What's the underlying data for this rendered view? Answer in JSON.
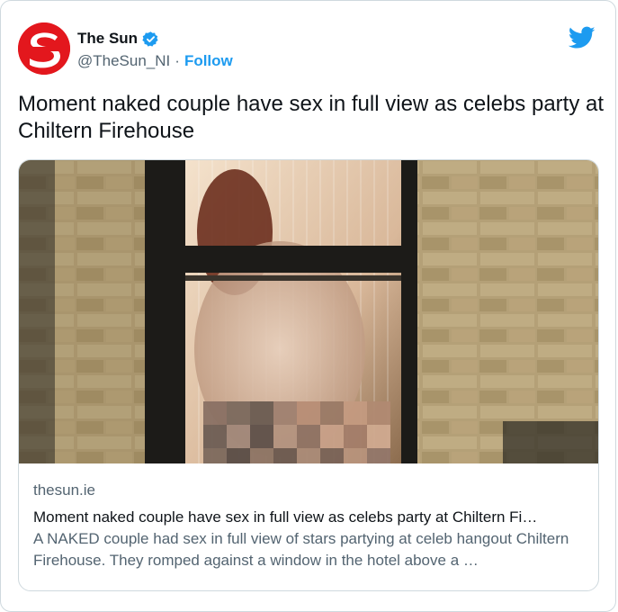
{
  "author": {
    "display_name": "The Sun",
    "handle": "@TheSun_NI",
    "separator": "·",
    "follow_label": "Follow",
    "avatar_letter": "S",
    "avatar_color": "#e3171d",
    "verified": true
  },
  "platform_icon": "twitter-bird-icon",
  "tweet": {
    "text": "Moment naked couple have sex in full view as celebs party at Chiltern Firehouse"
  },
  "card": {
    "domain": "thesun.ie",
    "title": "Moment naked couple have sex in full view as celebs party at Chiltern Fi…",
    "description": "A NAKED couple had sex in full view of stars partying at celeb hangout Chiltern Firehouse. They romped against a window in the hotel above a …"
  },
  "colors": {
    "accent": "#1d9bf0",
    "text": "#0f1419",
    "secondary": "#536471",
    "border": "#cfd9de"
  }
}
